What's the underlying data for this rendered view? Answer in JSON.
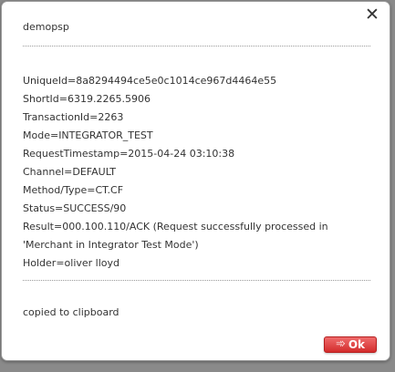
{
  "dialog": {
    "title": "demopsp",
    "close_icon": "close-icon",
    "close_glyph": "✕",
    "details": [
      "UniqueId=8a8294494ce5e0c1014ce967d4464e55",
      "ShortId=6319.2265.5906",
      "TransactionId=2263",
      "Mode=INTEGRATOR_TEST",
      "RequestTimestamp=2015-04-24 03:10:38",
      "Channel=DEFAULT",
      "Method/Type=CT.CF",
      "Status=SUCCESS/90",
      "Result=000.100.110/ACK (Request successfully processed in",
      "'Merchant in Integrator Test Mode')",
      "Holder=oliver lloyd"
    ],
    "status_message": "copied to clipboard",
    "ok_label": "Ok",
    "ok_icon": "arrow-right-icon",
    "ok_glyph": "➾",
    "accent_color": "#d32c2c"
  }
}
